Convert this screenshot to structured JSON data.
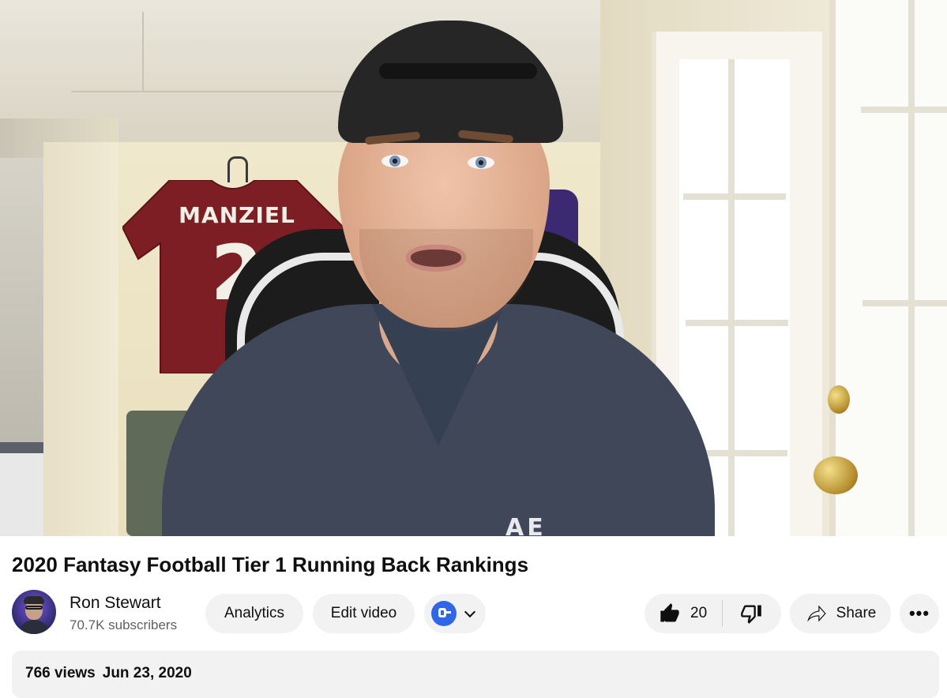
{
  "video": {
    "jersey_name": "MANZIEL",
    "jersey_number": "2",
    "shirt_text": "AE"
  },
  "title": "2020 Fantasy Football Tier 1 Running Back Rankings",
  "channel": {
    "name": "Ron Stewart",
    "subscribers": "70.7K subscribers"
  },
  "actions": {
    "analytics_label": "Analytics",
    "edit_label": "Edit video",
    "like_count": "20",
    "share_label": "Share",
    "more_label": "•••"
  },
  "description": {
    "views": "766 views",
    "date": "Jun 23, 2020"
  },
  "colors": {
    "promote_blue": "#2f67e8",
    "pill_bg": "#f2f2f2",
    "jersey_maroon": "#7d1e24"
  }
}
